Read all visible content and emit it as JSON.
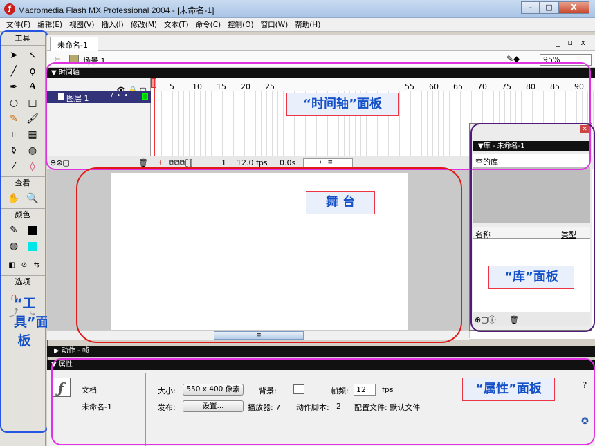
{
  "window": {
    "title": "Macromedia Flash MX Professional 2004 - [未命名-1]",
    "buttons": [
      "–",
      "□",
      "X"
    ]
  },
  "menu": [
    "文件(F)",
    "编辑(E)",
    "视图(V)",
    "插入(I)",
    "修改(M)",
    "文本(T)",
    "命令(C)",
    "控制(O)",
    "窗口(W)",
    "帮助(H)"
  ],
  "toolbox": {
    "header": "工具",
    "view_section": "查看",
    "color_section": "颜色",
    "options_section": "选项",
    "annotation": "“工具”面板"
  },
  "document": {
    "tab": "未命名-1",
    "tab_controls": "_ ▫ x",
    "scene": "场景 1",
    "zoom": "95%"
  },
  "timeline": {
    "title": "时间轴",
    "layer_name": "图层 1",
    "ruler": [
      "5",
      "10",
      "15",
      "20",
      "25",
      "55",
      "60",
      "65",
      "70",
      "75",
      "80",
      "85",
      "90"
    ],
    "current_frame": "1",
    "fps": "12.0 fps",
    "time": "0.0s",
    "annotation": "“时间轴”面板"
  },
  "stage": {
    "annotation": "舞 台"
  },
  "library": {
    "title": "▼库 - 未命名-1",
    "empty_label": "空的库",
    "col_name": "名称",
    "col_type": "类型",
    "annotation": "“库”面板"
  },
  "actions_panel": {
    "title": "▶ 动作 - 帧"
  },
  "properties": {
    "title": "属性",
    "doc_label": "文档",
    "doc_name": "未命名-1",
    "size_label": "大小:",
    "size_value": "550 x 400 像素",
    "bg_label": "背景:",
    "fps_label": "帧频:",
    "fps_value": "12",
    "fps_unit": "fps",
    "publish_label": "发布:",
    "settings_button": "设置...",
    "player_label": "播放器: 7",
    "script_label": "动作脚本:",
    "script_value": "2",
    "profile_label": "配置文件: 默认文件",
    "annotation": "“属性”面板"
  }
}
